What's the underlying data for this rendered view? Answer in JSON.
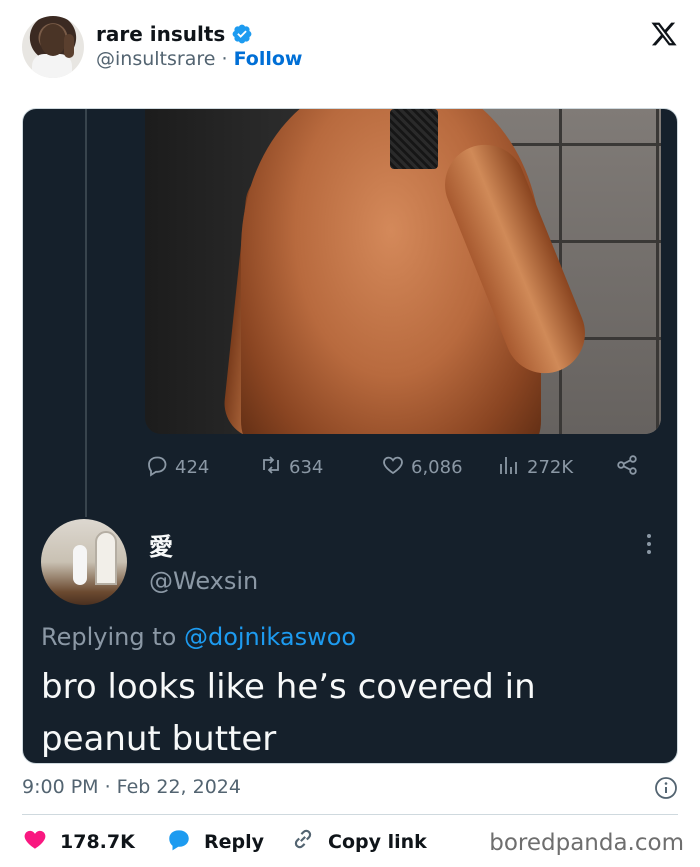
{
  "header": {
    "display_name": "rare insults",
    "handle": "@insultsrare",
    "separator": "·",
    "follow_label": "Follow"
  },
  "embedded_tweet": {
    "stats": {
      "replies": "424",
      "retweets": "634",
      "likes": "6,086",
      "views": "272K"
    },
    "reply": {
      "display_name": "愛",
      "handle": "@Wexsin",
      "replying_prefix": "Replying to",
      "replying_mention": "@dojnikaswoo",
      "text": "bro looks like he’s covered in peanut butter"
    }
  },
  "footer": {
    "timestamp": "9:00 PM · Feb 22, 2024",
    "like_count": "178.7K",
    "reply_label": "Reply",
    "copy_link_label": "Copy link",
    "watermark": "boredpanda.com"
  },
  "colors": {
    "card_background": "#15202b",
    "follow_blue": "#006fd6",
    "mention_blue": "#1d9bf0",
    "like_pink": "#f91880",
    "reply_blue": "#1d9bf0"
  },
  "icons": [
    "verified-badge-icon",
    "x-logo-icon",
    "reply-bubble-icon",
    "retweet-icon",
    "heart-icon",
    "views-chart-icon",
    "share-icon",
    "more-vertical-icon",
    "info-icon",
    "link-icon"
  ]
}
